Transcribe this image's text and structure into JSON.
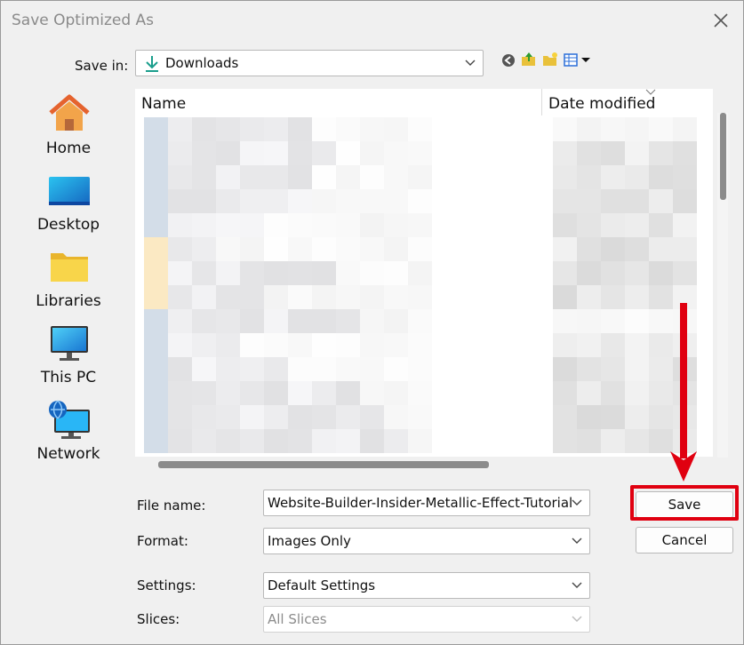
{
  "window": {
    "title": "Save Optimized As"
  },
  "save_in": {
    "label": "Save in:",
    "folder": "Downloads"
  },
  "sidebar": {
    "items": [
      {
        "label": "Home",
        "icon": "home-icon"
      },
      {
        "label": "Desktop",
        "icon": "desktop-icon"
      },
      {
        "label": "Libraries",
        "icon": "libraries-icon"
      },
      {
        "label": "This PC",
        "icon": "this-pc-icon"
      },
      {
        "label": "Network",
        "icon": "network-icon"
      }
    ]
  },
  "file_list": {
    "columns": [
      "Name",
      "Date modified"
    ]
  },
  "fields": {
    "file_name": {
      "label": "File name:",
      "value": "Website-Builder-Insider-Metallic-Effect-Tutorial"
    },
    "format": {
      "label": "Format:",
      "value": "Images Only"
    },
    "settings": {
      "label": "Settings:",
      "value": "Default Settings"
    },
    "slices": {
      "label": "Slices:",
      "value": "All Slices"
    }
  },
  "buttons": {
    "save": "Save",
    "cancel": "Cancel"
  },
  "colors": {
    "highlight": "#e00010",
    "folder_accent": "#1a9e8c",
    "desktop_blue": "#1e88e5",
    "folder_yellow": "#f6c533"
  }
}
